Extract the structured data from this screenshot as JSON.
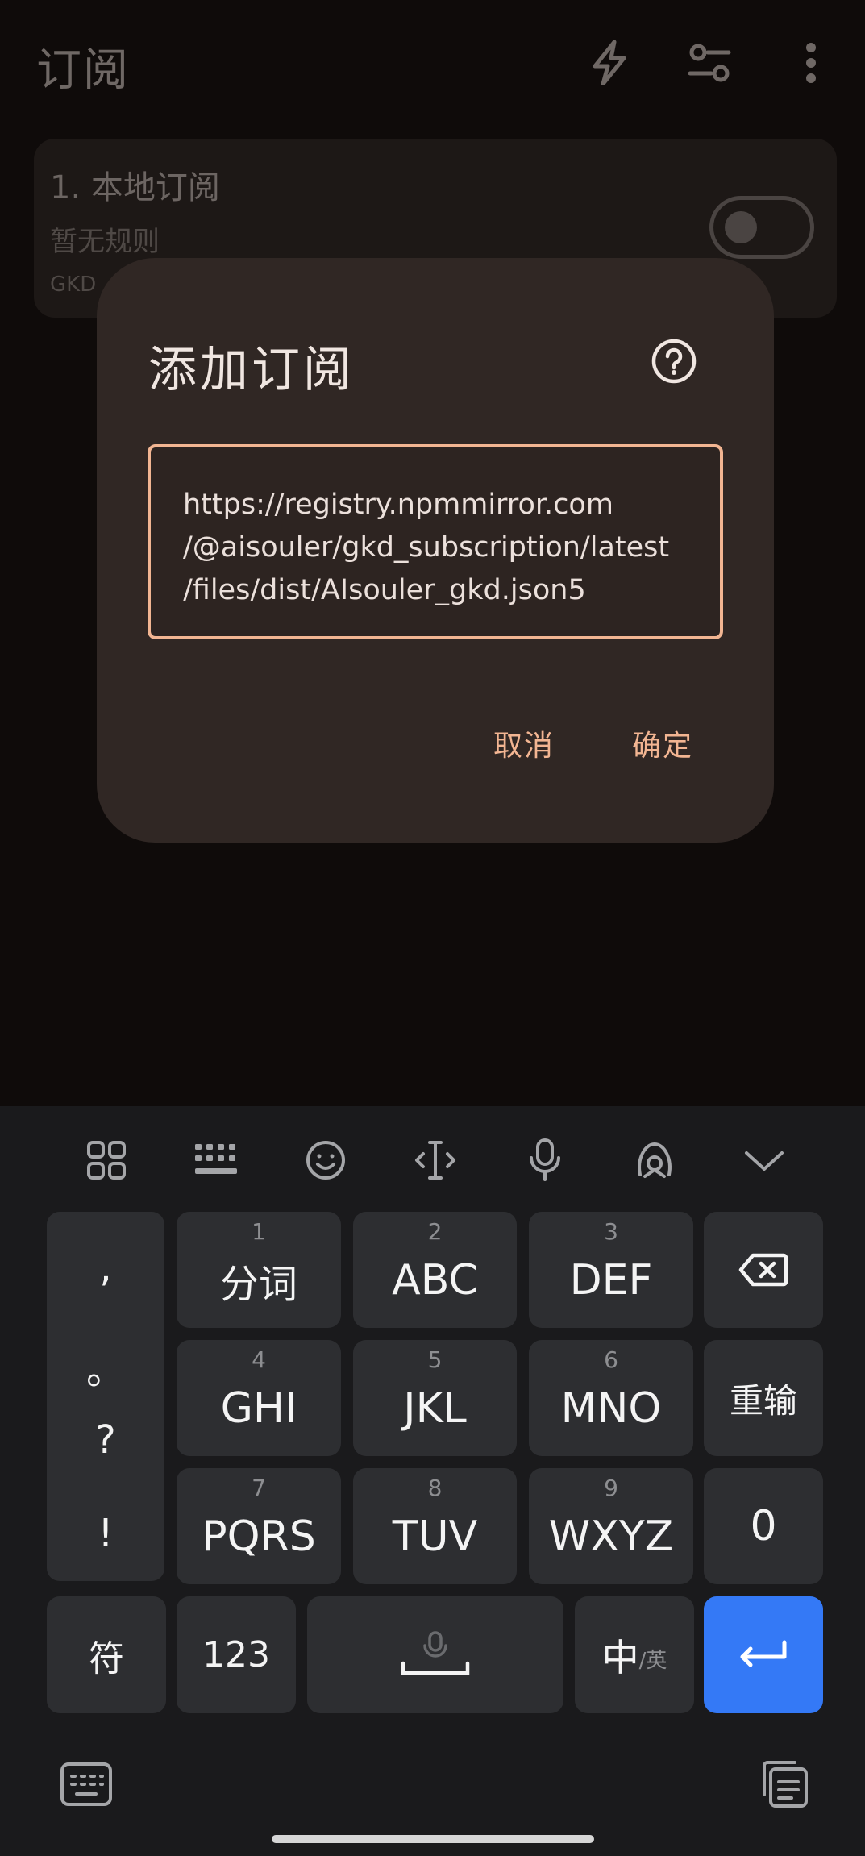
{
  "app": {
    "title": "订阅",
    "icons": [
      "flash-icon",
      "filter-settings-icon",
      "more-vert-icon"
    ],
    "subscription_card": {
      "title": "1. 本地订阅",
      "subtitle": "暂无规则",
      "footer": "GKD",
      "enabled": false
    }
  },
  "dialog": {
    "title": "添加订阅",
    "help_icon": "help-circle-icon",
    "url_value": "https://registry.npmmirror.com\n/@aisouler/gkd_subscription/latest\n/files/dist/AIsouler_gkd.json5",
    "cancel_label": "取消",
    "confirm_label": "确定",
    "accent_color": "#f2b592"
  },
  "keyboard": {
    "toolbar_icons": [
      "apps-grid-icon",
      "keyboard-layout-icon",
      "emoji-icon",
      "cursor-move-icon",
      "microphone-icon",
      "theme-icon",
      "collapse-icon"
    ],
    "punctuation": [
      ",",
      "。",
      "?",
      "!"
    ],
    "keys": [
      {
        "num": "1",
        "label": "分词"
      },
      {
        "num": "2",
        "label": "ABC"
      },
      {
        "num": "3",
        "label": "DEF"
      },
      {
        "num": "4",
        "label": "GHI"
      },
      {
        "num": "5",
        "label": "JKL"
      },
      {
        "num": "6",
        "label": "MNO"
      },
      {
        "num": "7",
        "label": "PQRS"
      },
      {
        "num": "8",
        "label": "TUV"
      },
      {
        "num": "9",
        "label": "WXYZ"
      }
    ],
    "reinput_label": "重输",
    "zero_label": "0",
    "symbol_label": "符",
    "num_label": "123",
    "lang_main": "中",
    "lang_alt": "/英",
    "enter_color": "#3479f6"
  }
}
